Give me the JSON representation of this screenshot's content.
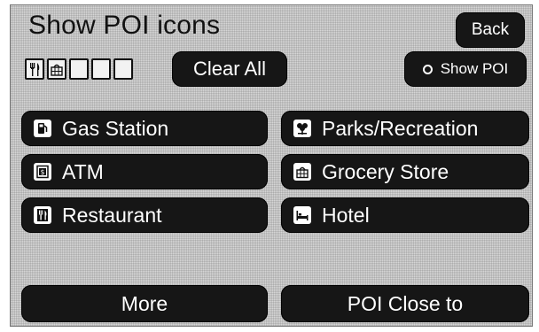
{
  "header": {
    "title": "Show POI icons",
    "back_label": "Back"
  },
  "selection": {
    "slots": [
      "restaurant-icon",
      "grocery-icon",
      "empty",
      "empty",
      "empty"
    ],
    "clear_label": "Clear All",
    "show_poi_label": "Show POI"
  },
  "categories": [
    {
      "label": "Gas Station",
      "icon": "gas-station-icon"
    },
    {
      "label": "Parks/Recreation",
      "icon": "parks-icon"
    },
    {
      "label": "ATM",
      "icon": "atm-icon"
    },
    {
      "label": "Grocery Store",
      "icon": "grocery-icon"
    },
    {
      "label": "Restaurant",
      "icon": "restaurant-icon"
    },
    {
      "label": "Hotel",
      "icon": "hotel-icon"
    }
  ],
  "footer": {
    "more_label": "More",
    "poi_close_label": "POI Close to"
  },
  "colors": {
    "button": "#161616",
    "background": "#d6d6d6",
    "text_on_button": "#ffffff"
  }
}
